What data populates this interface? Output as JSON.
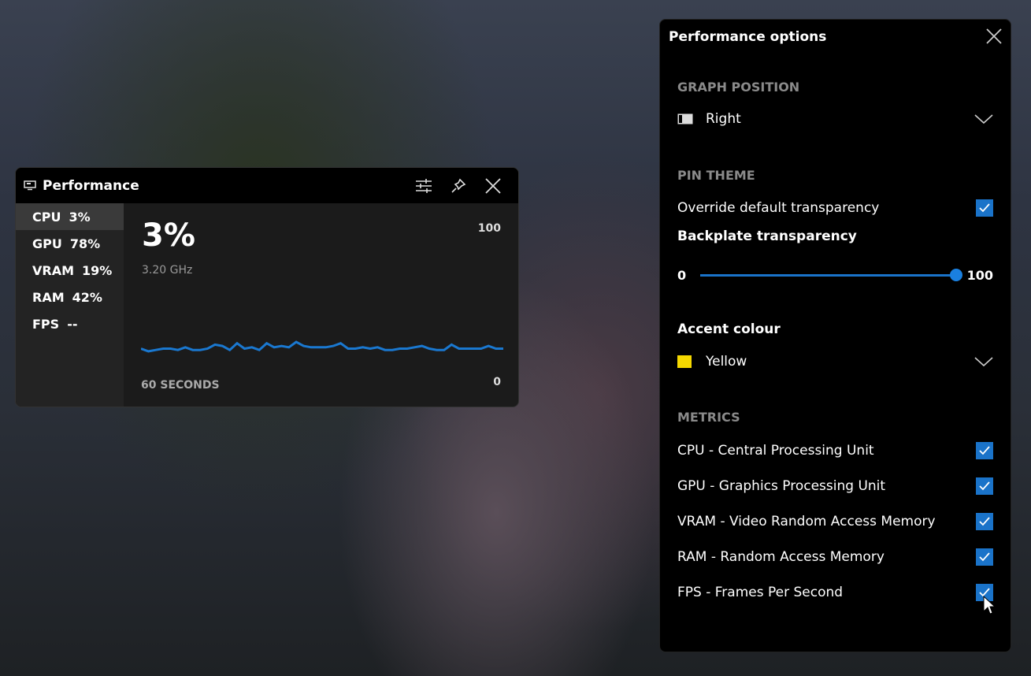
{
  "widget": {
    "title": "Performance",
    "metrics": [
      {
        "name": "CPU",
        "value": "3%"
      },
      {
        "name": "GPU",
        "value": "78%"
      },
      {
        "name": "VRAM",
        "value": "19%"
      },
      {
        "name": "RAM",
        "value": "42%"
      },
      {
        "name": "FPS",
        "value": "--"
      }
    ],
    "selected_value": "3%",
    "frequency": "3.20 GHz",
    "axis_max": "100",
    "axis_min": "0",
    "time_label": "60 SECONDS",
    "graph_samples": [
      15,
      13,
      14,
      15,
      15,
      14,
      16,
      14,
      14,
      15,
      18,
      17,
      14,
      19,
      15,
      16,
      14,
      19,
      16,
      17,
      16,
      20,
      17,
      16,
      16,
      16,
      17,
      19,
      15,
      15,
      16,
      15,
      16,
      14,
      14,
      15,
      15,
      16,
      17,
      15,
      14,
      14,
      18,
      15,
      15,
      15,
      15,
      17,
      15,
      15
    ],
    "accent": "#1a78d0"
  },
  "options": {
    "title": "Performance options",
    "graph_position": {
      "heading": "GRAPH POSITION",
      "value": "Right"
    },
    "pin_theme": {
      "heading": "PIN THEME",
      "override_label": "Override default transparency",
      "override_checked": true,
      "backplate_label": "Backplate transparency",
      "slider_min": "0",
      "slider_max": "100",
      "slider_value": 100
    },
    "accent": {
      "label": "Accent colour",
      "value": "Yellow",
      "color": "#f5d800"
    },
    "metrics": {
      "heading": "METRICS",
      "items": [
        {
          "label": "CPU - Central Processing Unit",
          "checked": true
        },
        {
          "label": "GPU - Graphics Processing Unit",
          "checked": true
        },
        {
          "label": "VRAM - Video Random Access Memory",
          "checked": true
        },
        {
          "label": "RAM - Random Access Memory",
          "checked": true
        },
        {
          "label": "FPS - Frames Per Second",
          "checked": true
        }
      ]
    }
  }
}
